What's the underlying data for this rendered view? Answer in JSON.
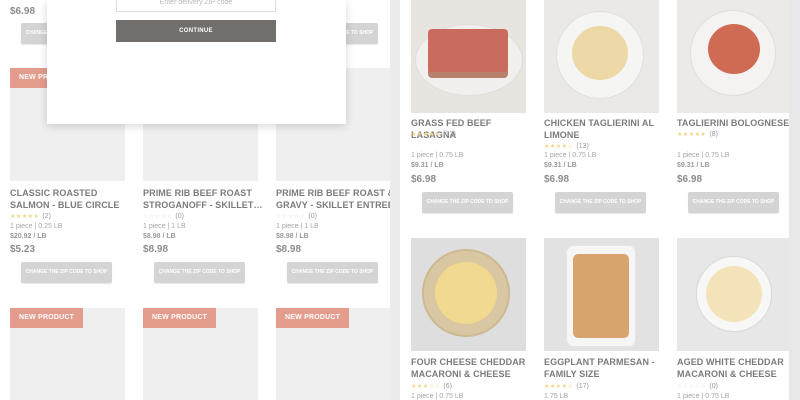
{
  "modal": {
    "zip_placeholder": "Enter delivery ZIP code",
    "continue_label": "CONTINUE"
  },
  "left_top": {
    "price": "$6.98",
    "buttons": [
      "CHANGE THE ZIP CODE TO SHOP",
      "CHANGE THE ZIP CODE TO SHOP"
    ]
  },
  "left_products": [
    {
      "badge": "NEW PRODUCT",
      "name": "CLASSIC ROASTED SALMON - BLUE CIRCLE",
      "stars": "★★★★★",
      "rating_count": "(2)",
      "pack": "1 piece | 0.25 LB",
      "unit_price": "$20.92 / LB",
      "price": "$5.23",
      "button": "CHANGE THE ZIP CODE TO SHOP"
    },
    {
      "badge": "",
      "name": "PRIME RIB BEEF ROAST STROGANOFF - SKILLET…",
      "stars": "☆☆☆☆☆",
      "rating_count": "(0)",
      "pack": "1 piece | 1 LB",
      "unit_price": "$8.98 / LB",
      "price": "$8.98",
      "button": "CHANGE THE ZIP CODE TO SHOP"
    },
    {
      "badge": "",
      "name": "PRIME RIB BEEF ROAST & GRAVY - SKILLET ENTREE",
      "stars": "☆☆☆☆☆",
      "rating_count": "(0)",
      "pack": "1 piece | 1 LB",
      "unit_price": "$8.98 / LB",
      "price": "$8.98",
      "button": "CHANGE THE ZIP CODE TO SHOP"
    }
  ],
  "left_bottom_badges": [
    "NEW PRODUCT",
    "NEW PRODUCT",
    "NEW PRODUCT"
  ],
  "right_products": [
    {
      "name": "GRASS FED BEEF LASAGNA",
      "stars": "★★★★★",
      "rating_count": "(13)",
      "pack": "1 piece | 0.75 LB",
      "unit_price": "$9.31 / LB",
      "price": "$6.98",
      "button": "CHANGE THE ZIP CODE TO SHOP"
    },
    {
      "name": "CHICKEN TAGLIERINI AL LIMONE",
      "stars": "★★★★☆",
      "rating_count": "(13)",
      "pack": "1 piece | 0.75 LB",
      "unit_price": "$9.31 / LB",
      "price": "$6.98",
      "button": "CHANGE THE ZIP CODE TO SHOP"
    },
    {
      "name": "TAGLIERINI BOLOGNESE",
      "stars": "★★★★★",
      "rating_count": "(8)",
      "pack": "1 piece | 0.75 LB",
      "unit_price": "$9.31 / LB",
      "price": "$6.98",
      "button": "CHANGE THE ZIP CODE TO SHOP"
    }
  ],
  "right_bottom_products": [
    {
      "name": "FOUR CHEESE CHEDDAR MACARONI & CHEESE",
      "stars": "★★★☆☆",
      "rating_count": "(6)",
      "pack": "1 piece | 0.75 LB"
    },
    {
      "name": "EGGPLANT PARMESAN - FAMILY SIZE",
      "stars": "★★★★☆",
      "rating_count": "(17)",
      "pack": "1.75 LB"
    },
    {
      "name": "AGED WHITE CHEDDAR MACARONI & CHEESE",
      "stars": "☆☆☆☆☆",
      "rating_count": "(0)",
      "pack": "1 piece | 0.75 LB"
    }
  ],
  "colors": {
    "badge": "#e49c8c",
    "button": "#d4d4d4",
    "continue": "#716e6b",
    "star": "#f3d588"
  }
}
